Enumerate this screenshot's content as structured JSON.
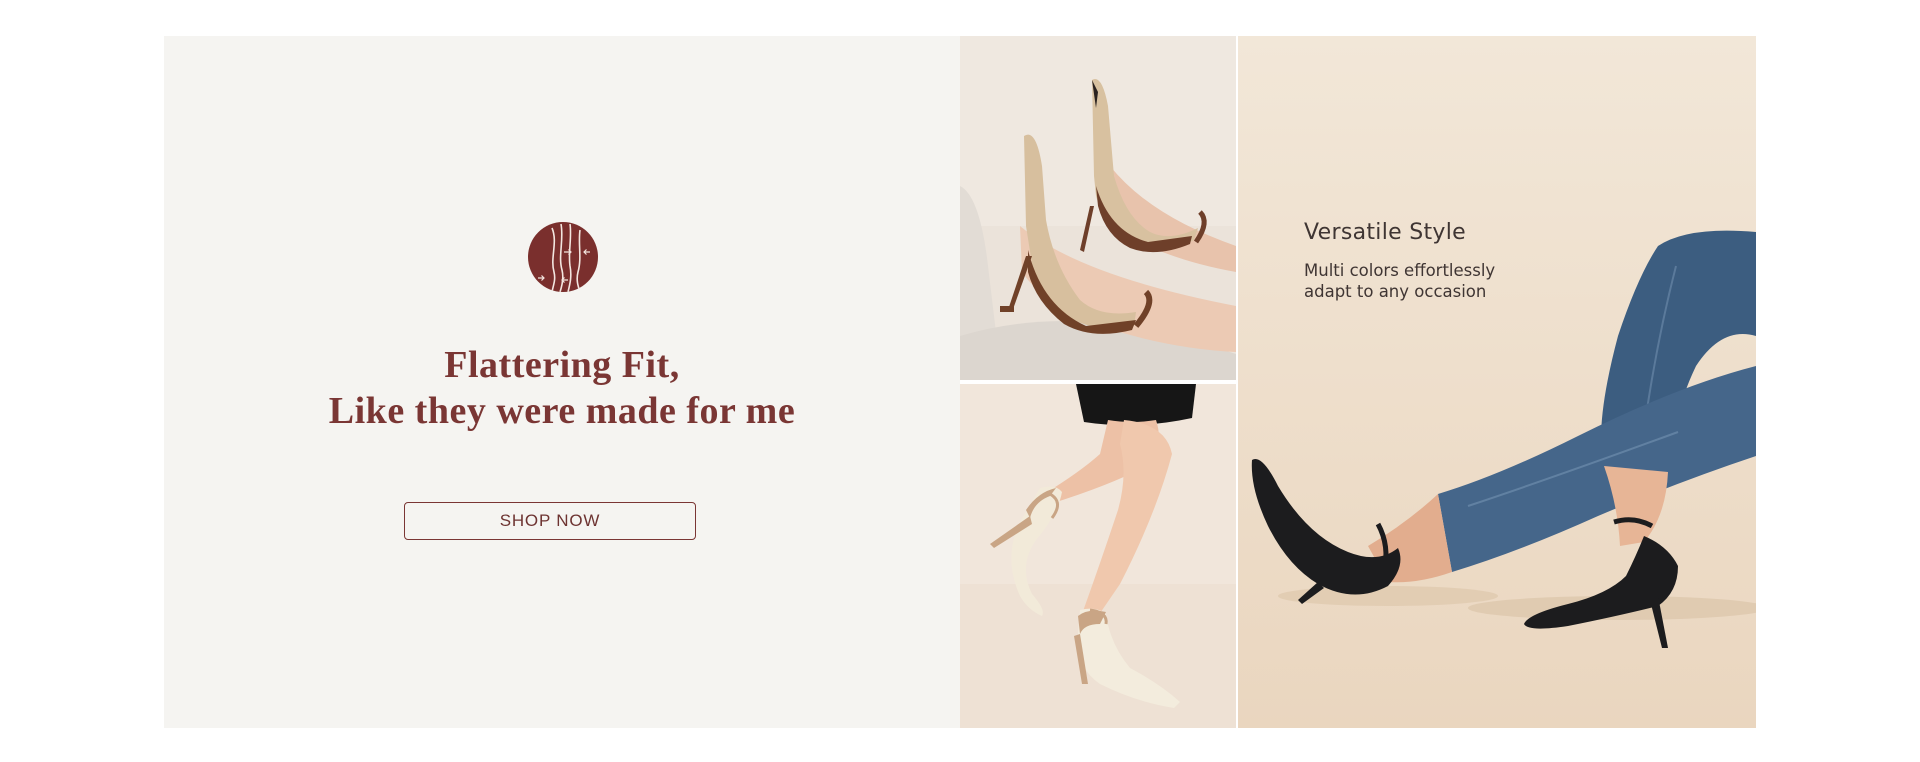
{
  "promo": {
    "headline_line1": "Flattering Fit,",
    "headline_line2": "Like they were made for me",
    "cta_label": "SHOP NOW",
    "badge_icon": "fit-legs-icon",
    "accent_color": "#7a3634",
    "background_color": "#f5f4f1"
  },
  "tiles": {
    "right": {
      "title": "Versatile Style",
      "subtitle_line1": "Multi colors effortlessly",
      "subtitle_line2": "adapt to any occasion"
    }
  }
}
